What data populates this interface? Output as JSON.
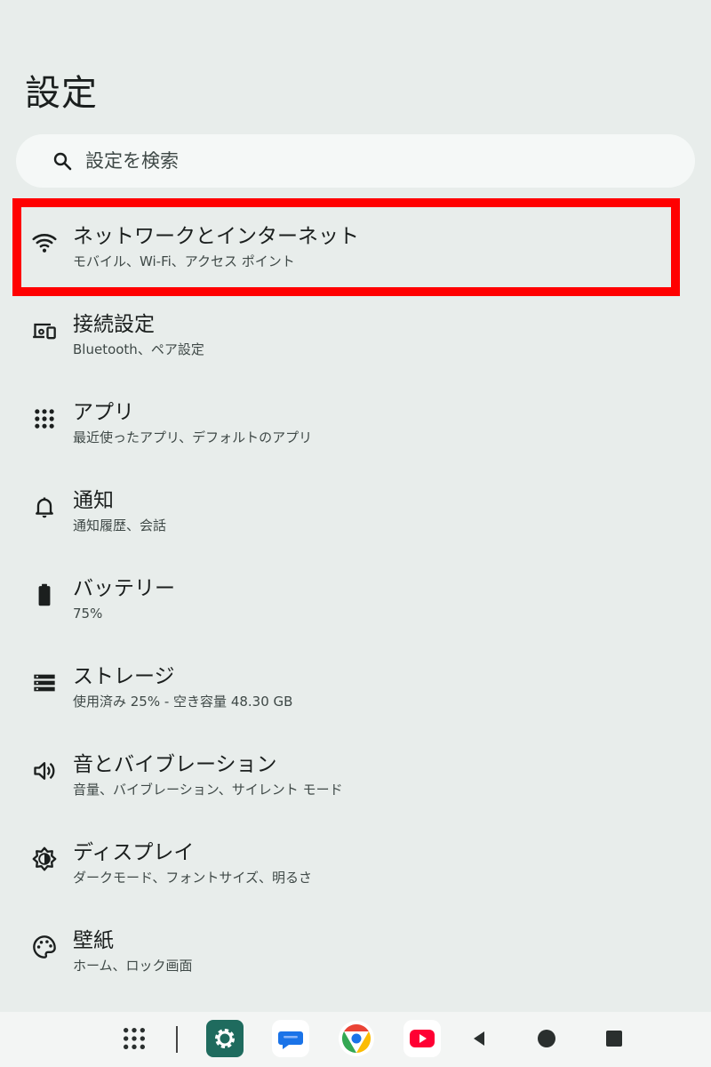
{
  "header": {
    "title": "設定"
  },
  "search": {
    "placeholder": "設定を検索"
  },
  "settings": [
    {
      "title": "ネットワークとインターネット",
      "subtitle": "モバイル、Wi-Fi、アクセス ポイント",
      "icon": "wifi-icon"
    },
    {
      "title": "接続設定",
      "subtitle": "Bluetooth、ペア設定",
      "icon": "devices-icon"
    },
    {
      "title": "アプリ",
      "subtitle": "最近使ったアプリ、デフォルトのアプリ",
      "icon": "apps-grid-icon"
    },
    {
      "title": "通知",
      "subtitle": "通知履歴、会話",
      "icon": "bell-icon"
    },
    {
      "title": "バッテリー",
      "subtitle": "75%",
      "icon": "battery-icon"
    },
    {
      "title": "ストレージ",
      "subtitle": "使用済み 25% - 空き容量 48.30 GB",
      "icon": "storage-icon"
    },
    {
      "title": "音とバイブレーション",
      "subtitle": "音量、バイブレーション、サイレント モード",
      "icon": "volume-icon"
    },
    {
      "title": "ディスプレイ",
      "subtitle": "ダークモード、フォントサイズ、明るさ",
      "icon": "brightness-icon"
    },
    {
      "title": "壁紙",
      "subtitle": "ホーム、ロック画面",
      "icon": "palette-icon"
    }
  ],
  "taskbar": {
    "apps": [
      "app-drawer-icon",
      "settings-app-icon",
      "messages-app-icon",
      "chrome-app-icon",
      "youtube-app-icon"
    ],
    "nav": [
      "back-icon",
      "home-icon",
      "recents-icon"
    ]
  },
  "colors": {
    "background": "#e8edeb",
    "highlight": "#ff0000",
    "settings_app": "#1f6b5e"
  }
}
